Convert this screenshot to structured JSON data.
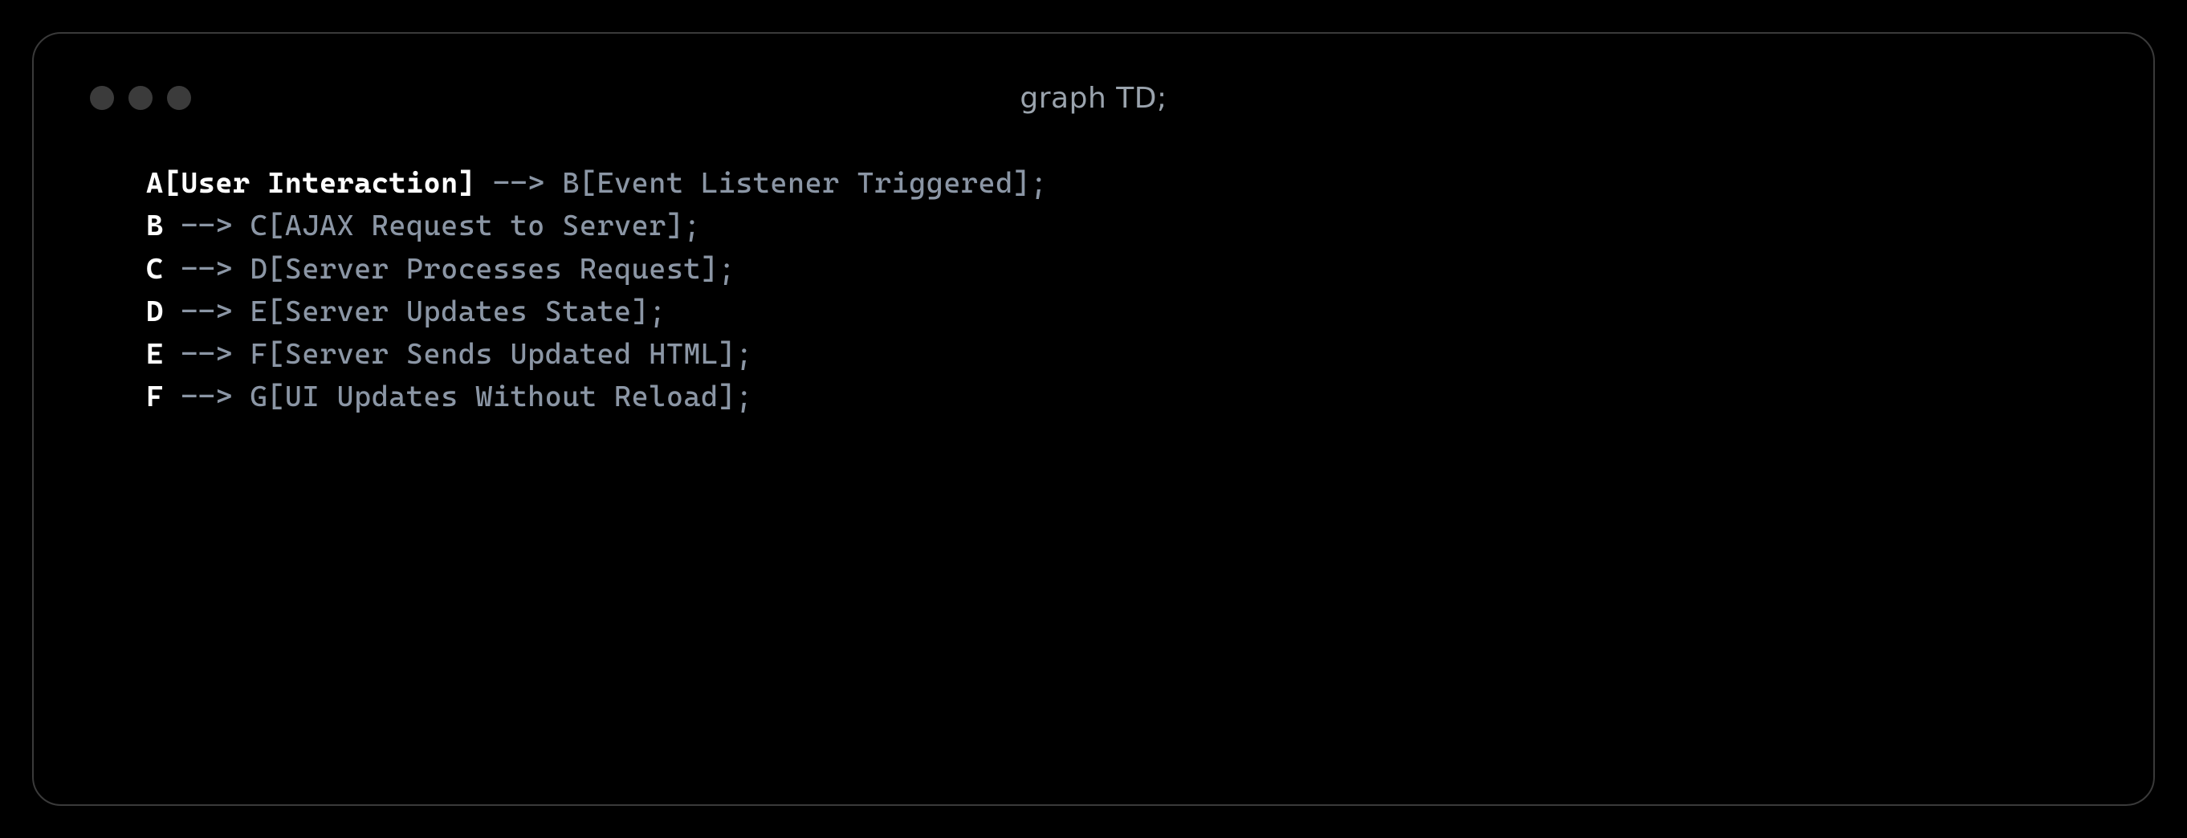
{
  "window": {
    "title": "graph TD;"
  },
  "code": {
    "lines": [
      {
        "segments": [
          {
            "cls": "tok-white",
            "text": "A[User Interaction]"
          },
          {
            "cls": "tok-gray",
            "text": " --> B[Event Listener Triggered];"
          }
        ]
      },
      {
        "segments": [
          {
            "cls": "tok-white",
            "text": "B"
          },
          {
            "cls": "tok-gray",
            "text": " --> C[AJAX Request to Server];"
          }
        ]
      },
      {
        "segments": [
          {
            "cls": "tok-white",
            "text": "C"
          },
          {
            "cls": "tok-gray",
            "text": " --> D[Server Processes Request];"
          }
        ]
      },
      {
        "segments": [
          {
            "cls": "tok-white",
            "text": "D"
          },
          {
            "cls": "tok-gray",
            "text": " --> E[Server Updates State];"
          }
        ]
      },
      {
        "segments": [
          {
            "cls": "tok-white",
            "text": "E"
          },
          {
            "cls": "tok-gray",
            "text": " --> F[Server Sends Updated HTML];"
          }
        ]
      },
      {
        "segments": [
          {
            "cls": "tok-white",
            "text": "F"
          },
          {
            "cls": "tok-gray",
            "text": " --> G[UI Updates Without Reload];"
          }
        ]
      }
    ]
  }
}
